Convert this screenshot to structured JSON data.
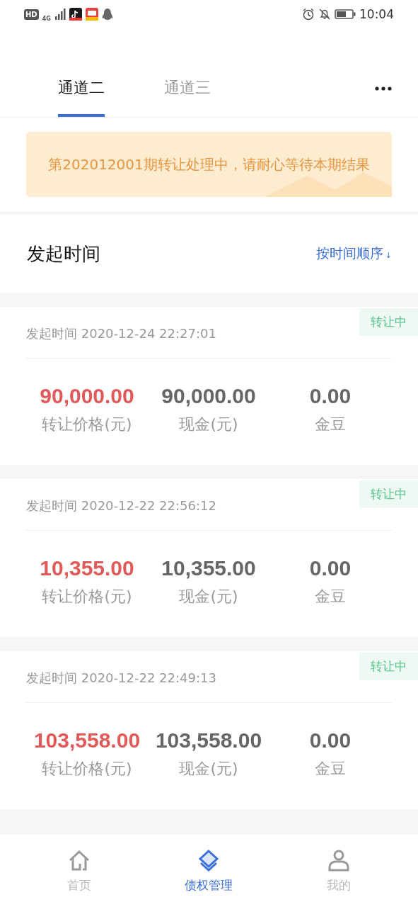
{
  "status_bar": {
    "hd": "HD",
    "network": "4G",
    "time": "10:04"
  },
  "tabs": [
    {
      "label": "通道二",
      "selected": true
    },
    {
      "label": "通道三",
      "selected": false
    }
  ],
  "notice": "第202012001期转让处理中，请耐心等待本期结果",
  "list_header": {
    "title": "发起时间",
    "sort": "按时间顺序",
    "sort_arrow": "↓"
  },
  "records": [
    {
      "time": "发起时间 2020-12-24 22:27:01",
      "status": "转让中",
      "price": "90,000.00",
      "price_label": "转让价格(元)",
      "cash": "90,000.00",
      "cash_label": "现金(元)",
      "beans": "0.00",
      "beans_label": "金豆"
    },
    {
      "time": "发起时间 2020-12-22 22:56:12",
      "status": "转让中",
      "price": "10,355.00",
      "price_label": "转让价格(元)",
      "cash": "10,355.00",
      "cash_label": "现金(元)",
      "beans": "0.00",
      "beans_label": "金豆"
    },
    {
      "time": "发起时间 2020-12-22 22:49:13",
      "status": "转让中",
      "price": "103,558.00",
      "price_label": "转让价格(元)",
      "cash": "103,558.00",
      "cash_label": "现金(元)",
      "beans": "0.00",
      "beans_label": "金豆"
    }
  ],
  "bottom_nav": [
    {
      "kind": "home",
      "label": "首页",
      "selected": false
    },
    {
      "kind": "layers",
      "label": "债权管理",
      "selected": true
    },
    {
      "kind": "person",
      "label": "我的",
      "selected": false
    }
  ]
}
